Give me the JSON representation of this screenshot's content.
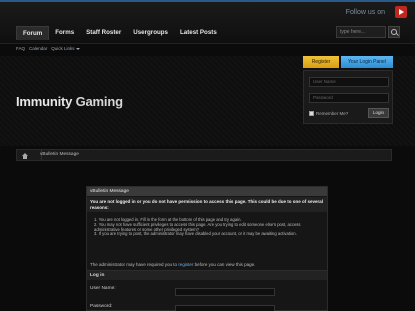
{
  "topbar": {
    "follow_text": "Follow us on",
    "social_icon": "youtube-icon"
  },
  "nav": {
    "tabs": [
      {
        "label": "Forum",
        "active": true
      },
      {
        "label": "Forms",
        "active": false
      },
      {
        "label": "Staff Roster",
        "active": false
      },
      {
        "label": "Usergroups",
        "active": false
      },
      {
        "label": "Latest Posts",
        "active": false
      }
    ],
    "search_placeholder": "type here..."
  },
  "subnav": {
    "faq": "FAQ",
    "calendar": "Calendar",
    "quick_links": "Quick Links"
  },
  "header": {
    "logo_word1": "Immunity",
    "logo_word2": "Gaming"
  },
  "auth": {
    "register_label": "Register",
    "login_panel_label": "Your Login Panel",
    "username_placeholder": "User Name",
    "password_placeholder": "Password",
    "remember_label": "Remember Me?",
    "login_button": "Login"
  },
  "breadcrumb": {
    "current": "vBulletin Message"
  },
  "message": {
    "title": "vBulletin Message",
    "warning": "You are not logged in or you do not have permission to access this page. This could be due to one of several reasons:",
    "reasons": [
      "1. You are not logged in. Fill in the form at the bottom of this page and try again.",
      "2. You may not have sufficient privileges to access this page. Are you trying to edit someone else's post, access administrative features or some other privileged system?",
      "3. If you are trying to post, the administrator may have disabled your account, or it may be awaiting activation."
    ],
    "footer_prefix": "The administrator may have required you to",
    "footer_link": "register",
    "footer_suffix": "before you can view this page."
  },
  "login_form": {
    "title": "Log in",
    "username_label": "User Name:",
    "password_label": "Password:"
  },
  "colors": {
    "register_btn": "#e6b024",
    "login_panel_btn": "#3ea0e0",
    "link": "#6fb0e6"
  }
}
